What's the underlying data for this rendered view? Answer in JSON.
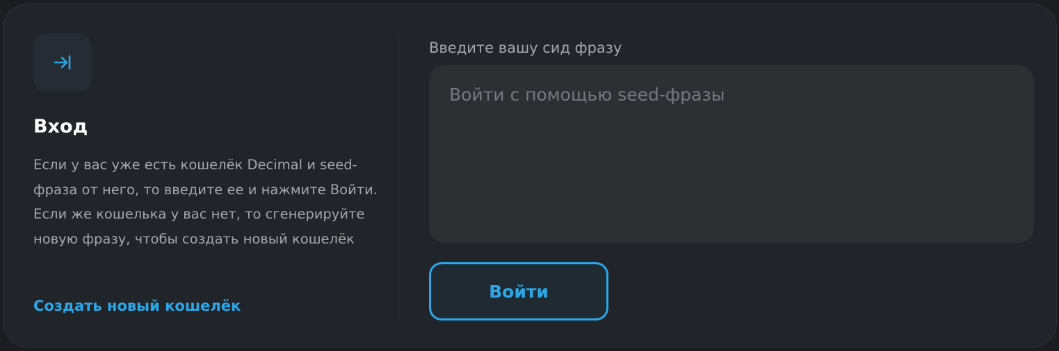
{
  "colors": {
    "accent": "#2ba8ea",
    "background": "#1b1d21",
    "card": "#212428",
    "input_bg": "#2d2f33"
  },
  "login": {
    "icon": "login-arrow-icon",
    "title": "Вход",
    "description": "Если у вас уже есть кошелёк Decimal и seed-фраза от него, то введите ее и нажмите Войти. Если же кошелька у вас нет, то сгенерируйте новую фразу, чтобы создать новый кошелёк",
    "create_wallet_link": "Создать новый кошелёк"
  },
  "seed": {
    "label": "Введите вашу сид фразу",
    "placeholder": "Войти с помощью seed-фразы",
    "value": ""
  },
  "submit": {
    "label": "Войти"
  }
}
